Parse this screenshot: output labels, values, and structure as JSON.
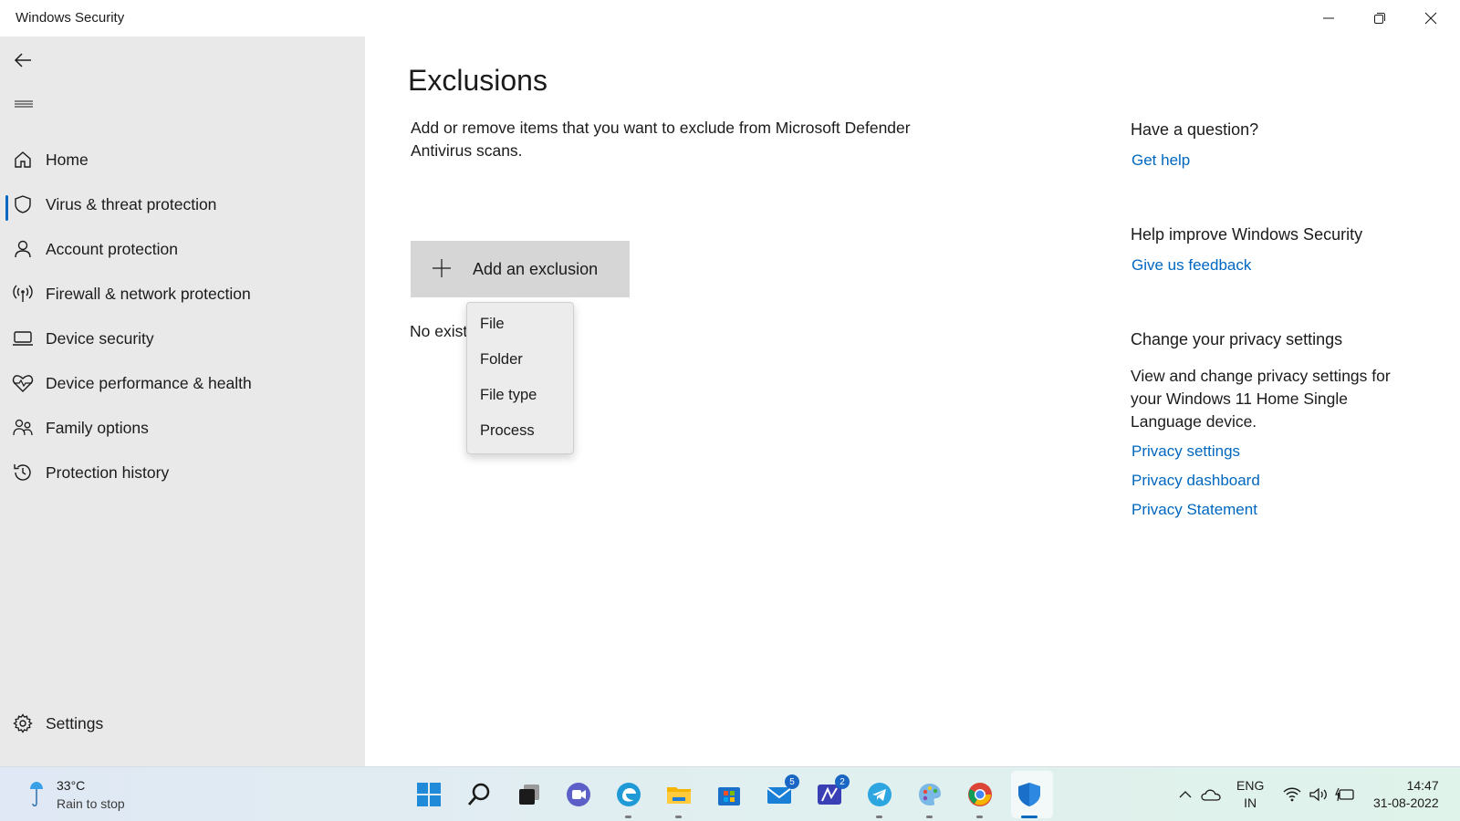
{
  "window": {
    "title": "Windows Security"
  },
  "sidebar": {
    "items": [
      {
        "label": "Home",
        "icon": "home-icon"
      },
      {
        "label": "Virus & threat protection",
        "icon": "shield-icon",
        "active": true
      },
      {
        "label": "Account protection",
        "icon": "person-icon"
      },
      {
        "label": "Firewall & network protection",
        "icon": "antenna-icon"
      },
      {
        "label": "Device security",
        "icon": "laptop-icon"
      },
      {
        "label": "Device performance & health",
        "icon": "heart-icon"
      },
      {
        "label": "Family options",
        "icon": "family-icon"
      },
      {
        "label": "Protection history",
        "icon": "history-icon"
      }
    ],
    "settings_label": "Settings"
  },
  "main": {
    "title": "Exclusions",
    "description": "Add or remove items that you want to exclude from Microsoft Defender Antivirus scans.",
    "add_button_label": "Add an exclusion",
    "no_items_text": "No existing exclusions.",
    "dropdown_options": [
      "File",
      "Folder",
      "File type",
      "Process"
    ]
  },
  "right_panel": {
    "question_heading": "Have a question?",
    "get_help": "Get help",
    "improve_heading": "Help improve Windows Security",
    "feedback": "Give us feedback",
    "privacy_heading": "Change your privacy settings",
    "privacy_text": "View and change privacy settings for your Windows 11 Home Single Language device.",
    "privacy_settings": "Privacy settings",
    "privacy_dashboard": "Privacy dashboard",
    "privacy_statement": "Privacy Statement"
  },
  "taskbar": {
    "weather_temp": "33°C",
    "weather_desc": "Rain to stop",
    "mail_badge": "5",
    "app_badge": "2",
    "lang_line1": "ENG",
    "lang_line2": "IN",
    "time": "14:47",
    "date": "31-08-2022"
  },
  "colors": {
    "accent": "#0067c0",
    "sidebar_bg": "#e9e9e9",
    "button_bg": "#d6d6d6"
  }
}
